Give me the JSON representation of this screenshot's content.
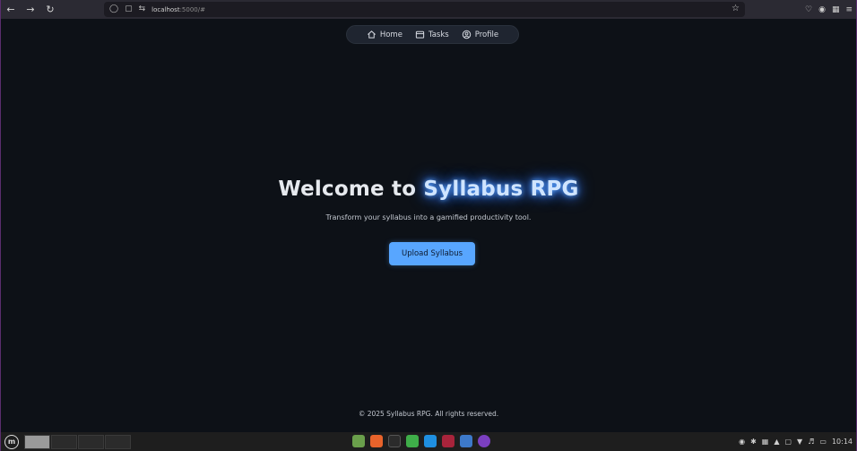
{
  "browser": {
    "url_host": "localhost",
    "url_rest": ":5000/#",
    "nav_back": "←",
    "nav_forward": "→",
    "nav_reload": "↻"
  },
  "nav": {
    "items": [
      {
        "label": "Home",
        "icon": "home-icon"
      },
      {
        "label": "Tasks",
        "icon": "tasks-icon"
      },
      {
        "label": "Profile",
        "icon": "profile-icon"
      }
    ]
  },
  "hero": {
    "title_prefix": "Welcome to ",
    "title_brand": "Syllabus RPG",
    "subtitle": "Transform your syllabus into a gamified productivity tool.",
    "upload_label": "Upload Syllabus"
  },
  "footer": {
    "text": "© 2025 Syllabus RPG. All rights reserved."
  },
  "taskbar": {
    "clock": "10:14",
    "menu_glyph": "m"
  },
  "colors": {
    "background": "#0d1117",
    "accent": "#58a6ff",
    "brand_glow": "#3b82f6"
  }
}
